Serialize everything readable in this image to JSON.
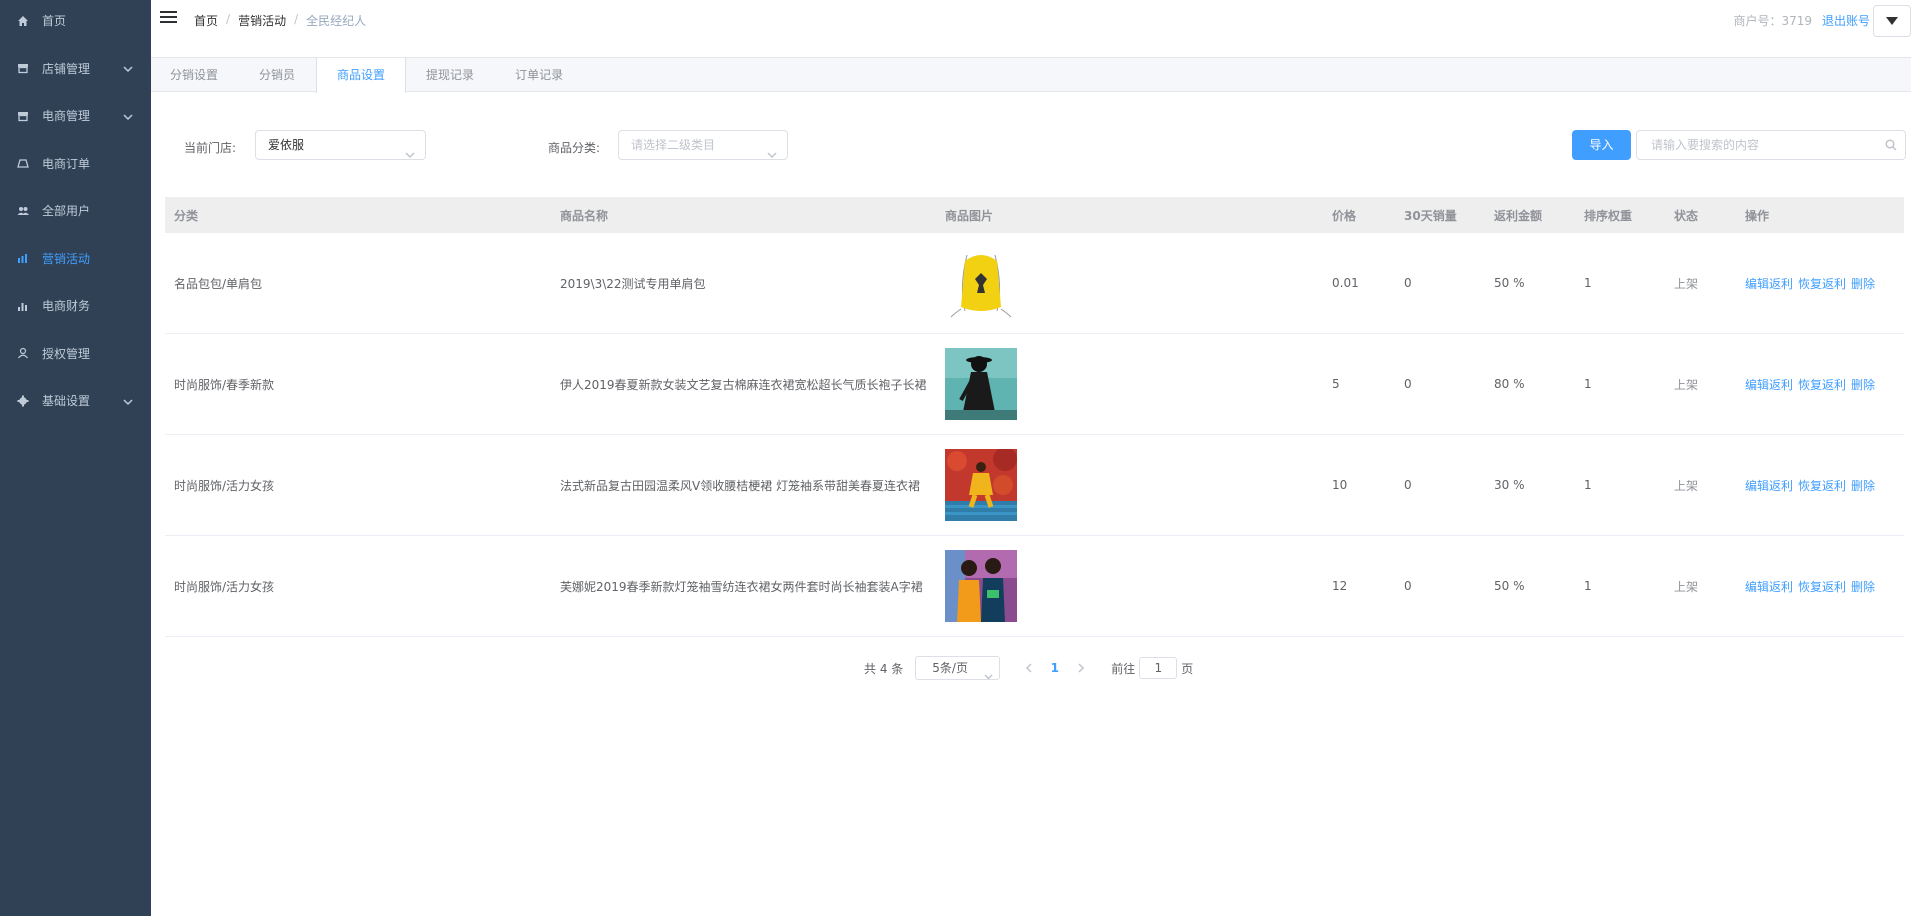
{
  "sidebar": {
    "items": [
      {
        "label": "首页",
        "icon": "home-icon",
        "active": false
      },
      {
        "label": "店铺管理",
        "icon": "store-icon",
        "expandable": true
      },
      {
        "label": "电商管理",
        "icon": "store-icon",
        "expandable": true
      },
      {
        "label": "电商订单",
        "icon": "order-icon"
      },
      {
        "label": "全部用户",
        "icon": "users-icon"
      },
      {
        "label": "营销活动",
        "icon": "marketing-icon",
        "active": true
      },
      {
        "label": "电商财务",
        "icon": "finance-icon"
      },
      {
        "label": "授权管理",
        "icon": "user-icon"
      },
      {
        "label": "基础设置",
        "icon": "gear-icon",
        "expandable": true
      }
    ]
  },
  "header": {
    "breadcrumb": [
      "首页",
      "营销活动",
      "全民经纪人"
    ],
    "merchant": "商户号：3719",
    "logout": "退出账号"
  },
  "tabs": [
    "分销设置",
    "分销员",
    "商品设置",
    "提现记录",
    "订单记录"
  ],
  "active_tab": 2,
  "filters": {
    "store_label": "当前门店:",
    "store_value": "爱依服",
    "category_label": "商品分类:",
    "category_placeholder": "请选择二级类目",
    "import_label": "导入",
    "search_placeholder": "请输入要搜索的内容"
  },
  "table": {
    "headers": [
      "分类",
      "商品名称",
      "商品图片",
      "价格",
      "30天销量",
      "返利金额",
      "排序权重",
      "状态",
      "操作"
    ],
    "rows": [
      {
        "category": "名品包包/单肩包",
        "name": "2019\\3\\22测试专用单肩包",
        "price": "0.01",
        "sales": "0",
        "rebate": "50 %",
        "sort": "1",
        "status": "上架",
        "image": "yellow-bag"
      },
      {
        "category": "时尚服饰/春季新款",
        "name": "伊人2019春夏新款女装文艺复古棉麻连衣裙宽松超长气质长袍子长裙",
        "price": "5",
        "sales": "0",
        "rebate": "80 %",
        "sort": "1",
        "status": "上架",
        "image": "teal-dress"
      },
      {
        "category": "时尚服饰/活力女孩",
        "name": "法式新品复古田园温柔风V领收腰桔梗裙 灯笼袖系带甜美春夏连衣裙",
        "price": "10",
        "sales": "0",
        "rebate": "30 %",
        "sort": "1",
        "status": "上架",
        "image": "red-yellow"
      },
      {
        "category": "时尚服饰/活力女孩",
        "name": "芙娜妮2019春季新款灯笼袖雪纺连衣裙女两件套时尚长袖套装A字裙",
        "price": "12",
        "sales": "0",
        "rebate": "50 %",
        "sort": "1",
        "status": "上架",
        "image": "two-girls"
      }
    ],
    "ops": [
      "编辑返利",
      "恢复返利",
      "删除"
    ]
  },
  "pagination": {
    "total": "共 4 条",
    "page_size": "5条/页",
    "current": "1",
    "goto_label": "前往",
    "goto_value": "1",
    "goto_suffix": "页"
  },
  "colors": {
    "sidebar_bg": "#304156",
    "primary": "#409eff",
    "sidebar_text": "#bfcbd9"
  }
}
